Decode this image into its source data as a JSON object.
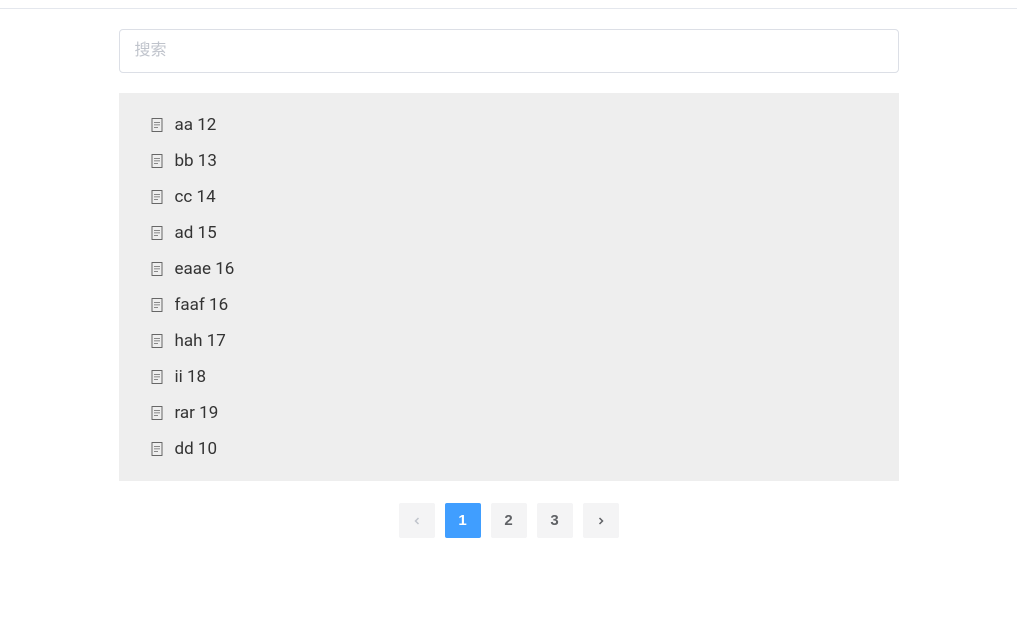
{
  "search": {
    "placeholder": "搜索"
  },
  "list": {
    "items": [
      {
        "name": "aa",
        "value": "12"
      },
      {
        "name": "bb",
        "value": "13"
      },
      {
        "name": "cc",
        "value": "14"
      },
      {
        "name": "ad",
        "value": "15"
      },
      {
        "name": "eaae",
        "value": "16"
      },
      {
        "name": "faaf",
        "value": "16"
      },
      {
        "name": "hah",
        "value": "17"
      },
      {
        "name": "ii",
        "value": "18"
      },
      {
        "name": "rar",
        "value": "19"
      },
      {
        "name": "dd",
        "value": "10"
      }
    ]
  },
  "pagination": {
    "pages": [
      "1",
      "2",
      "3"
    ],
    "current": 1
  }
}
